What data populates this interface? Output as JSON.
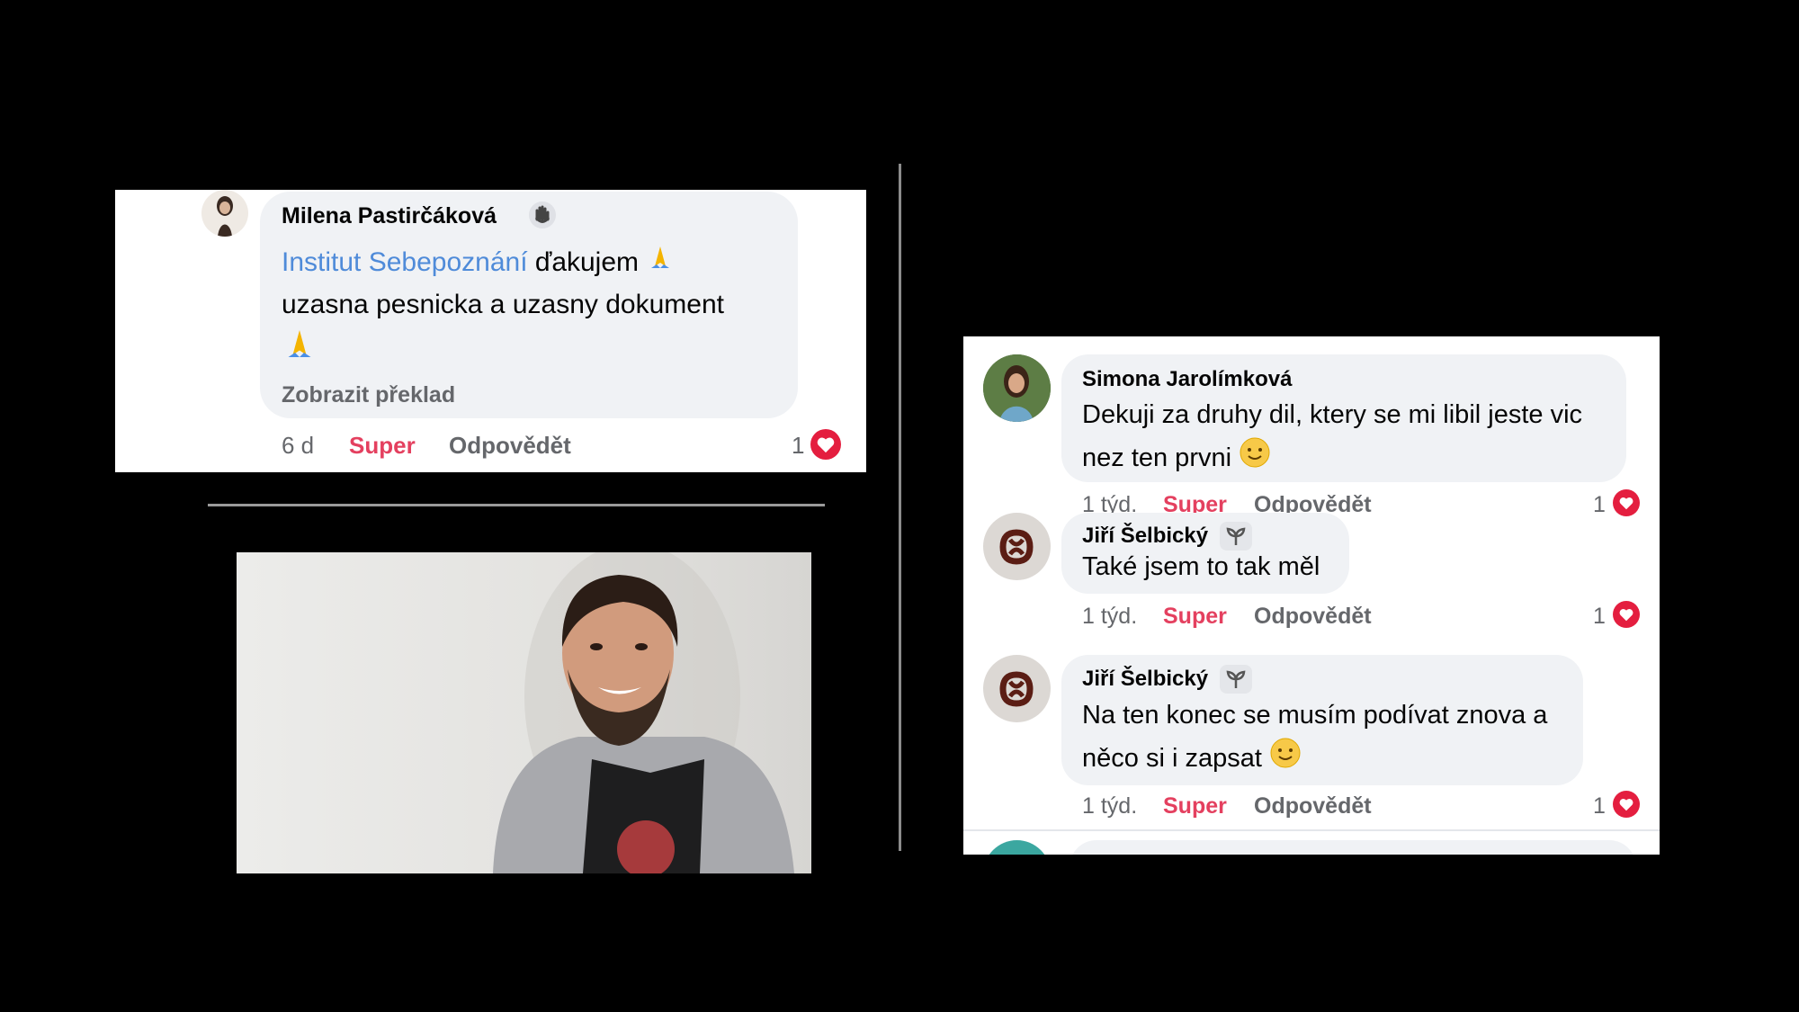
{
  "left_comment": {
    "author": "Milena Pastirčáková",
    "author_badge_icon": "hand-wave-icon",
    "mention": "Institut Sebepoznání",
    "text_line1_after_mention": "ďakujem",
    "text_line2": "uzasna pesnicka a uzasny dokument",
    "emoji_icon": "folded-hands-emoji",
    "translate_link": "Zobrazit překlad",
    "time": "6 d",
    "like_action": "Super",
    "reply_action": "Odpovědět",
    "reaction_count": "1",
    "reaction_icon": "heart-icon"
  },
  "right_comments": [
    {
      "author": "Simona Jarolímková",
      "text_line1": "Dekuji za druhy dil, ktery se mi libil jeste vic",
      "text_line2": "nez ten prvni",
      "time": "1 týd.",
      "like_action": "Super",
      "reply_action": "Odpovědět",
      "reaction_count": "1"
    },
    {
      "author": "Jiří Šelbický",
      "author_badge_icon": "seedling-icon",
      "text_line1": "Také jsem to tak měl",
      "time": "1 týd.",
      "like_action": "Super",
      "reply_action": "Odpovědět",
      "reaction_count": "1"
    },
    {
      "author": "Jiří Šelbický",
      "author_badge_icon": "seedling-icon",
      "text_line1": "Na ten konec se musím podívat znova a",
      "text_line2": "něco si i zapsat",
      "time": "1 týd.",
      "like_action": "Super",
      "reply_action": "Odpovědět",
      "reaction_count": "1"
    }
  ],
  "colors": {
    "background": "#000000",
    "bubble": "#f0f2f5",
    "link": "#4f8bd9",
    "super": "#e4405f",
    "heart": "#e41e3f",
    "meta": "#65676b"
  }
}
